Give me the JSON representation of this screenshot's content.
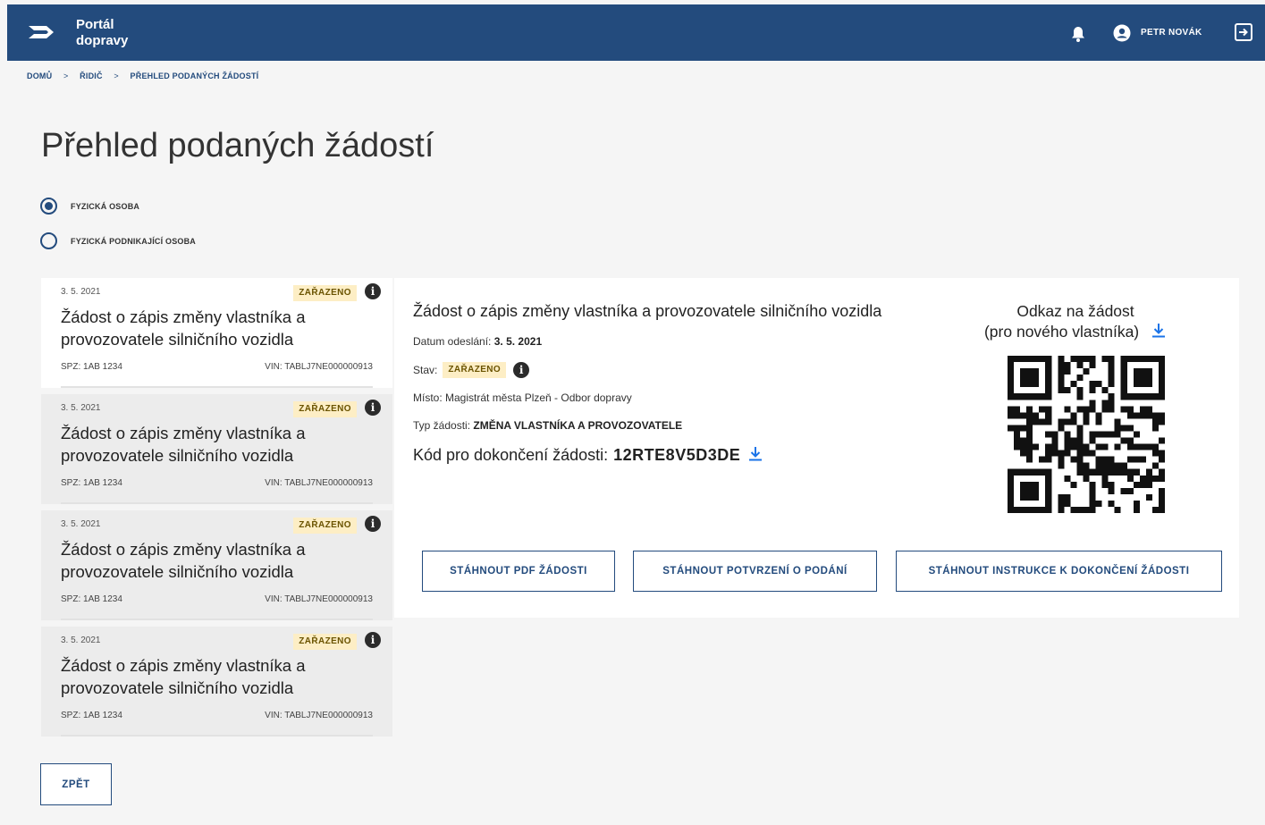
{
  "header": {
    "brand_line1": "Portál",
    "brand_line2": "dopravy",
    "username": "PETR NOVÁK",
    "icons": [
      "logo-icon",
      "bell-icon",
      "avatar-icon",
      "logout-icon"
    ],
    "bg_color": "#234b7d"
  },
  "breadcrumb": {
    "items": [
      "DOMŮ",
      "ŘIDIČ",
      "PŘEHLED PODANÝCH ŽÁDOSTÍ"
    ],
    "separator": ">"
  },
  "page": {
    "title": "Přehled podaných žádostí"
  },
  "person_type": {
    "options": [
      {
        "label": "FYZICKÁ OSOBA",
        "selected": true
      },
      {
        "label": "FYZICKÁ PODNIKAJÍCÍ OSOBA",
        "selected": false
      }
    ]
  },
  "requests": [
    {
      "date": "3. 5. 2021",
      "status": "ZAŘAZENO",
      "title": "Žádost o zápis změny vlastníka a provozovatele silničního vozidla",
      "spz": "SPZ: 1AB 1234",
      "vin": "VIN: TABLJ7NE000000913"
    },
    {
      "date": "3. 5. 2021",
      "status": "ZAŘAZENO",
      "title": "Žádost o zápis změny vlastníka a provozovatele silničního vozidla",
      "spz": "SPZ: 1AB 1234",
      "vin": "VIN: TABLJ7NE000000913"
    },
    {
      "date": "3. 5. 2021",
      "status": "ZAŘAZENO",
      "title": "Žádost o zápis změny vlastníka a provozovatele silničního vozidla",
      "spz": "SPZ: 1AB 1234",
      "vin": "VIN: TABLJ7NE000000913"
    },
    {
      "date": "3. 5. 2021",
      "status": "ZAŘAZENO",
      "title": "Žádost o zápis změny vlastníka a provozovatele silničního vozidla",
      "spz": "SPZ: 1AB 1234",
      "vin": "VIN: TABLJ7NE000000913"
    }
  ],
  "detail": {
    "title": "Žádost o zápis změny vlastníka a provozovatele silničního vozidla",
    "sent_label": "Datum odeslání:",
    "sent_value": "3. 5. 2021",
    "status_label": "Stav:",
    "status_value": "ZAŘAZENO",
    "place": "Místo: Magistrát města Plzeň - Odbor dopravy",
    "type_label": "Typ žádosti:",
    "type_value": "ZMĚNA VLASTNÍKA A PROVOZOVATELE",
    "code_label": "Kód pro dokončení žádosti:",
    "code_value": "12RTE8V5D3DE",
    "qr_label_line1": "Odkaz na žádost",
    "qr_label_line2": "(pro nového vlastníka)",
    "buttons": {
      "pdf": "STÁHNOUT PDF ŽÁDOSTI",
      "confirmation": "STÁHNOUT POTVRZENÍ O PODÁNÍ",
      "instructions": "STÁHNOUT INSTRUKCE K DOKONČENÍ ŽÁDOSTI"
    }
  },
  "footer": {
    "back_label": "ZPĚT"
  },
  "colors": {
    "primary": "#234b7d",
    "badge_bg": "#fdeec5",
    "badge_text": "#6a5300",
    "link_blue": "#1a73e8"
  }
}
